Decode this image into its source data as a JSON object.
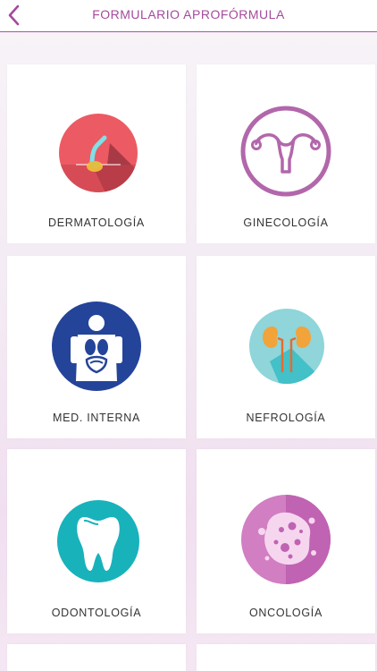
{
  "header": {
    "title": "FORMULARIO APROFÓRMULA"
  },
  "specialties": [
    {
      "label": "DERMATOLOGÍA"
    },
    {
      "label": "GINECOLOGÍA"
    },
    {
      "label": "MED. INTERNA"
    },
    {
      "label": "NEFROLOGÍA"
    },
    {
      "label": "ODONTOLOGÍA"
    },
    {
      "label": "ONCOLOGÍA"
    }
  ],
  "colors": {
    "accent": "#a44a9d",
    "dermatology": "#ec5a63",
    "gynecology": "#b267ab",
    "internal_medicine": "#24449a",
    "nephrology": "#8fd5da",
    "dentistry": "#18b2bb",
    "oncology": "#d17ec3"
  }
}
